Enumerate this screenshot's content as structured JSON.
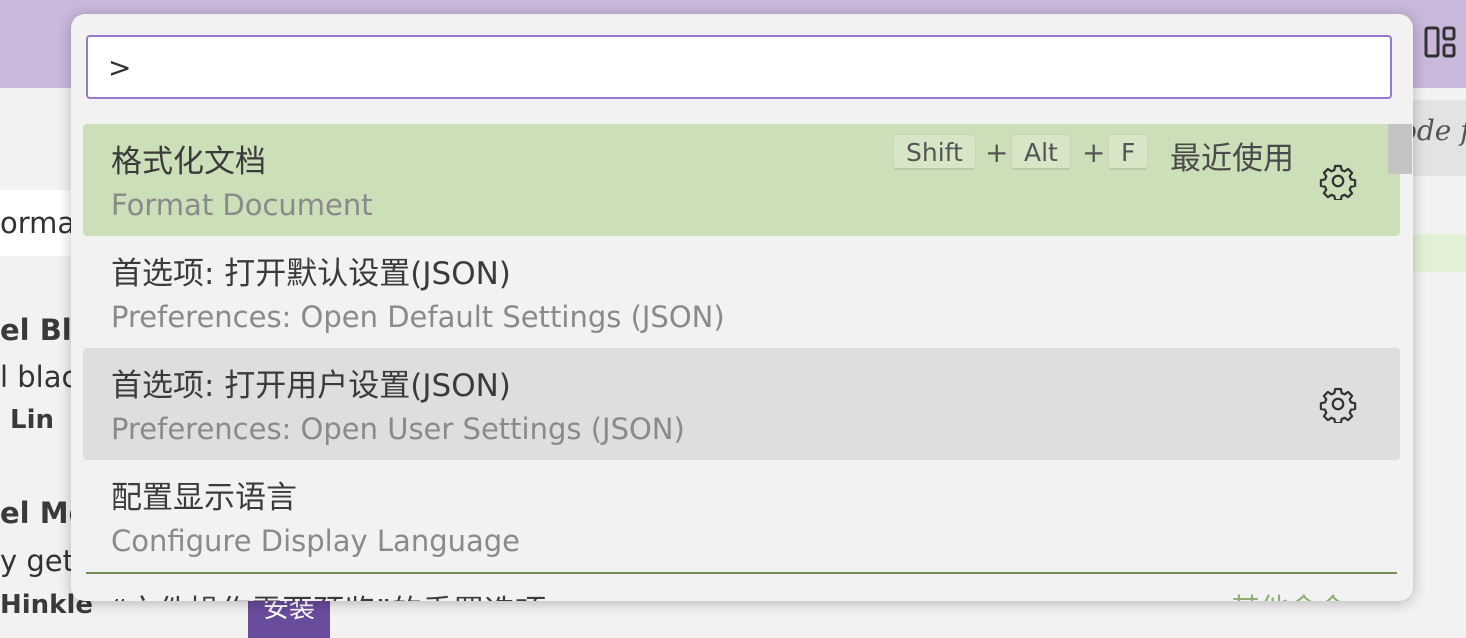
{
  "background": {
    "right_partial_text": "ode f",
    "left_search_partial": "orma",
    "extensions": [
      {
        "title": "el Bla",
        "description": "l blac",
        "author": "Lin"
      },
      {
        "title": "el Mo",
        "description": "y get",
        "author": "Hinkle"
      }
    ],
    "install_button": "安装"
  },
  "palette": {
    "input_value": ">",
    "items": [
      {
        "label": "格式化文档",
        "detail": "Format Document",
        "keybinding": [
          "Shift",
          "Alt",
          "F"
        ],
        "plus": "+",
        "tag": "最近使用",
        "icon": "gear-icon"
      },
      {
        "label": "首选项: 打开默认设置(JSON)",
        "detail": "Preferences: Open Default Settings (JSON)"
      },
      {
        "label": "首选项: 打开用户设置(JSON)",
        "detail": "Preferences: Open User Settings (JSON)",
        "icon": "gear-icon"
      },
      {
        "label": "配置显示语言",
        "detail": "Configure Display Language"
      },
      {
        "label": "“文件操作需要预览”的重置选项",
        "group": "其他命令"
      }
    ]
  },
  "colors": {
    "accent_border": "#9b78cf",
    "title_bar": "#c9b8db",
    "selected_row": "#cbdfb9",
    "hover_row": "#dedede"
  }
}
